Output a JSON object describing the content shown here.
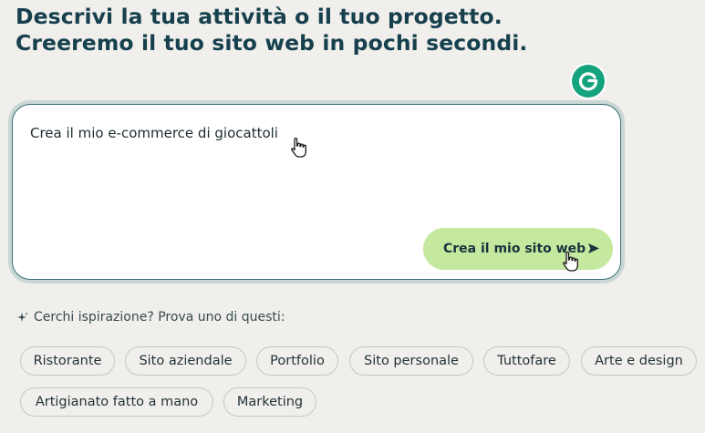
{
  "headline": {
    "line1": "Descrivi la tua attività o il tuo progetto.",
    "line2": "Creeremo il tuo sito web in pochi secondi."
  },
  "grammarly_badge": {
    "letter": "G"
  },
  "prompt": {
    "value": "Crea il mio e-commerce di giocattoli"
  },
  "create_button": {
    "label": "Crea il mio sito web"
  },
  "inspiration": {
    "label": "Cerchi ispirazione? Prova uno di questi:"
  },
  "chips": [
    "Ristorante",
    "Sito aziendale",
    "Portfolio",
    "Sito personale",
    "Tuttofare",
    "Arte e design",
    "Artigianato fatto a mano",
    "Marketing"
  ],
  "colors": {
    "background": "#f0efec",
    "headline": "#16404d",
    "button": "#c5e89f",
    "grammarly": "#14a37c"
  },
  "icons": {
    "sparkle": "sparkle-icon",
    "send": "send-arrow-icon",
    "cursor": "hand-pointer-icon"
  }
}
